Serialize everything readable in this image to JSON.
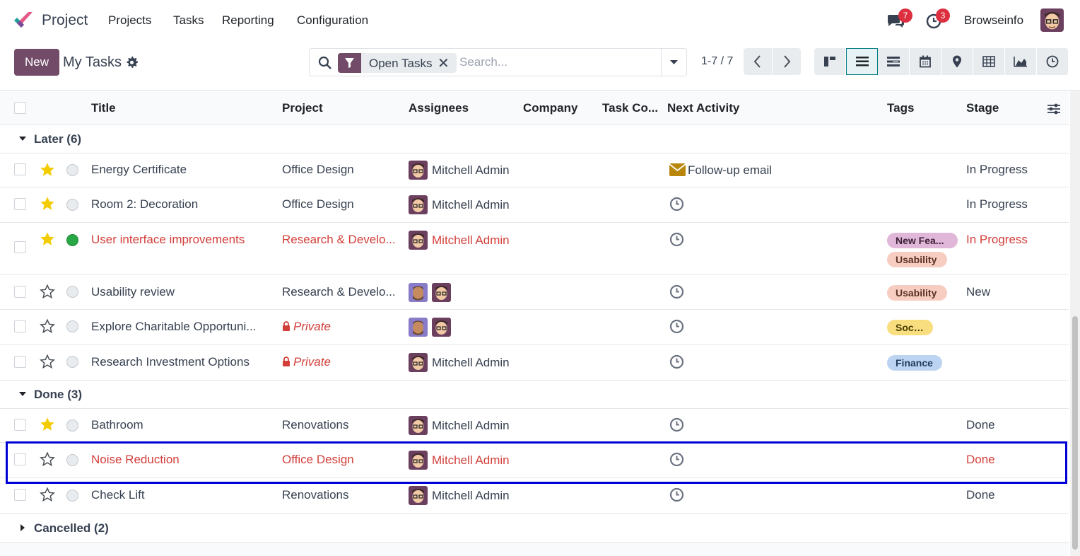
{
  "app": {
    "name": "Project"
  },
  "menu": [
    "Projects",
    "Tasks",
    "Reporting",
    "Configuration"
  ],
  "systray": {
    "messages_count": "7",
    "activities_count": "3",
    "user_name": "Browseinfo"
  },
  "control_panel": {
    "new_label": "New",
    "breadcrumb": "My Tasks",
    "search": {
      "facet": "Open Tasks",
      "facet_remove": "✕",
      "placeholder": "Search..."
    },
    "pager": "1-7 / 7"
  },
  "columns": [
    "Title",
    "Project",
    "Assignees",
    "Company",
    "Task Co...",
    "Next Activity",
    "Tags",
    "Stage"
  ],
  "groups": [
    {
      "label": "Later (6)"
    },
    {
      "label": "Done (3)"
    },
    {
      "label": "Cancelled (2)"
    }
  ],
  "rows": [
    {
      "title": "Energy Certificate",
      "project": "Office Design",
      "assignee": "Mitchell Admin",
      "activity": "Follow-up email",
      "stage": "In Progress",
      "starred": true
    },
    {
      "title": "Room 2: Decoration",
      "project": "Office Design",
      "assignee": "Mitchell Admin",
      "stage": "In Progress",
      "starred": true
    },
    {
      "title": "User interface improvements",
      "project": "Research & Develo...",
      "assignee": "Mitchell Admin",
      "tags": [
        "New Fea...",
        "Usability"
      ],
      "stage": "In Progress",
      "starred": true
    },
    {
      "title": "Usability review",
      "project": "Research & Develo...",
      "tags": [
        "Usability"
      ],
      "stage": "New",
      "starred": false
    },
    {
      "title": "Explore Charitable Opportuni...",
      "project": "Private",
      "tags": [
        "Social"
      ],
      "stage": "",
      "starred": false
    },
    {
      "title": "Research Investment Options",
      "project": "Private",
      "assignee": "Mitchell Admin",
      "tags": [
        "Finance"
      ],
      "stage": "",
      "starred": false
    },
    {
      "title": "Bathroom",
      "project": "Renovations",
      "assignee": "Mitchell Admin",
      "stage": "Done",
      "starred": true
    },
    {
      "title": "Noise Reduction",
      "project": "Office Design",
      "assignee": "Mitchell Admin",
      "stage": "Done",
      "starred": false
    },
    {
      "title": "Check Lift",
      "project": "Renovations",
      "assignee": "Mitchell Admin",
      "stage": "Done",
      "starred": false
    }
  ],
  "colors": {
    "brand": "#714b67",
    "overdue_red": "#d23f3a",
    "star_gold": "#f3cc00",
    "highlight": "#0000d4"
  }
}
